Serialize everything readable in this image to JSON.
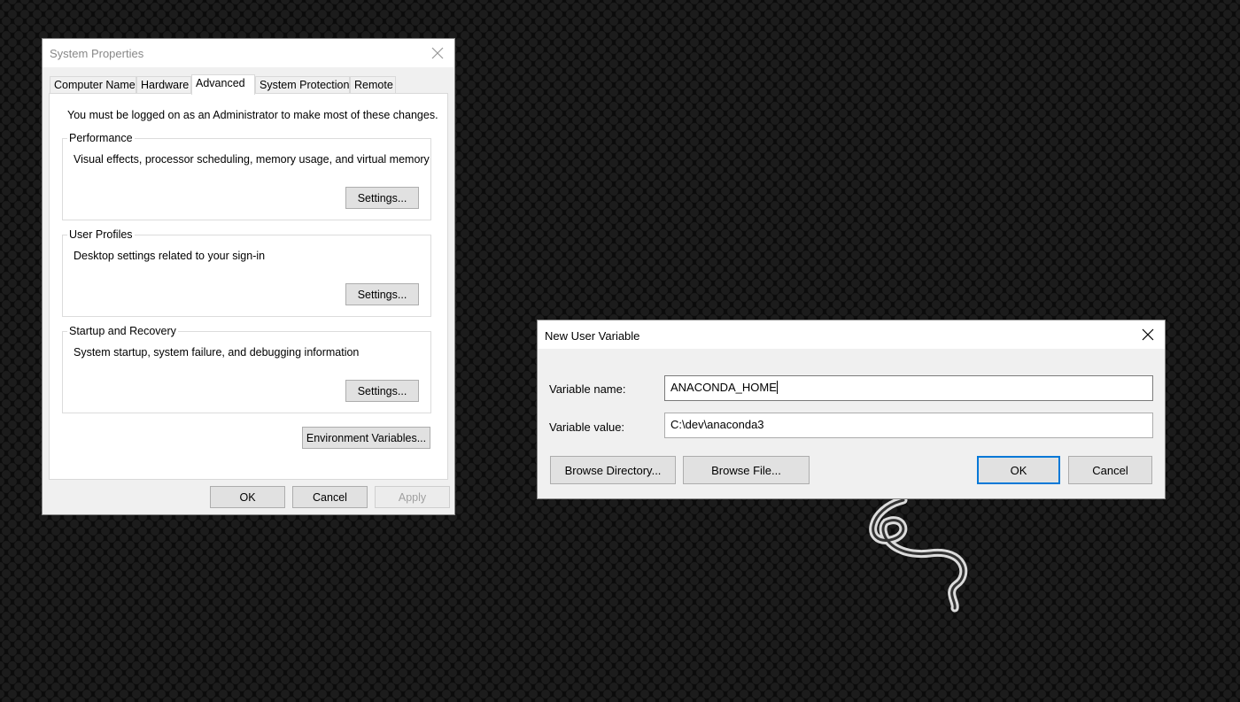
{
  "system_properties": {
    "title": "System Properties",
    "tabs": [
      {
        "label": "Computer Name"
      },
      {
        "label": "Hardware"
      },
      {
        "label": "Advanced"
      },
      {
        "label": "System Protection"
      },
      {
        "label": "Remote"
      }
    ],
    "active_tab": "Advanced",
    "notice": "You must be logged on as an Administrator to make most of these changes.",
    "groups": [
      {
        "label": "Performance",
        "description": "Visual effects, processor scheduling, memory usage, and virtual memory",
        "button": "Settings..."
      },
      {
        "label": "User Profiles",
        "description": "Desktop settings related to your sign-in",
        "button": "Settings..."
      },
      {
        "label": "Startup and Recovery",
        "description": "System startup, system failure, and debugging information",
        "button": "Settings..."
      }
    ],
    "env_button": "Environment Variables...",
    "footer": {
      "ok": "OK",
      "cancel": "Cancel",
      "apply": "Apply"
    }
  },
  "new_user_variable": {
    "title": "New User Variable",
    "name_label": "Variable name:",
    "name_value": "ANACONDA_HOME",
    "value_label": "Variable value:",
    "value_value": "C:\\dev\\anaconda3",
    "browse_directory": "Browse Directory...",
    "browse_file": "Browse File...",
    "ok": "OK",
    "cancel": "Cancel"
  },
  "desktop": {
    "logo_icon": "razer-snake-logo-icon"
  }
}
